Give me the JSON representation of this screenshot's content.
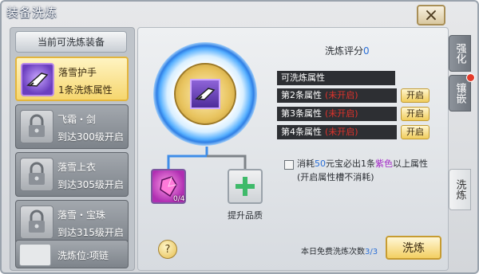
{
  "window": {
    "title": "装备洗炼",
    "close_glyph": "×"
  },
  "tabs": [
    {
      "label": "强化"
    },
    {
      "label": "镶嵌"
    },
    {
      "label": "洗炼"
    }
  ],
  "left": {
    "header": "当前可洗炼装备",
    "items": [
      {
        "name": "落雪护手",
        "sub": "1条洗炼属性",
        "selected": true,
        "icon": "glove-icon"
      },
      {
        "name": "飞霜・剑",
        "sub": "到达300级开启",
        "selected": false,
        "icon": "lock-icon"
      },
      {
        "name": "落雪上衣",
        "sub": "到达305级开启",
        "selected": false,
        "icon": "lock-icon"
      },
      {
        "name": "落雪・宝珠",
        "sub": "到达315级开启",
        "selected": false,
        "icon": "lock-icon"
      },
      {
        "name": "洗炼位:项链",
        "sub": "",
        "selected": false,
        "icon": "empty-slot"
      }
    ]
  },
  "center": {
    "score_label": "洗炼评分",
    "score_value": "0",
    "attr_header": "可洗炼属性",
    "rows": [
      {
        "label": "第2条属性",
        "status": "(未开启)",
        "button": "开启"
      },
      {
        "label": "第3条属性",
        "status": "(未开启)",
        "button": "开启"
      },
      {
        "label": "第4条属性",
        "status": "(未开启)",
        "button": "开启"
      }
    ],
    "note_prefix": "消耗",
    "note_amount": "50",
    "note_mid": "元宝必出1条",
    "note_purple": "紫色",
    "note_suffix": "以上属性",
    "note_line2": "(开启属性槽不消耗)",
    "material_count": "0/4",
    "upgrade_label": "提升品质",
    "help_glyph": "?",
    "free_label": "本日免费洗炼次数",
    "free_value": "3/3",
    "refine_button": "洗炼"
  },
  "colors": {
    "accent_gold": "#f3cf62",
    "highlight_blue": "#2a6fd6",
    "locked_red": "#e0322b",
    "purple": "#a32ac7"
  }
}
